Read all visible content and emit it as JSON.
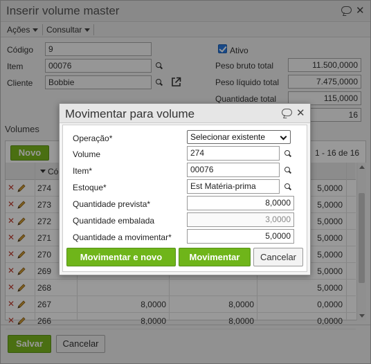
{
  "window": {
    "title": "Inserir volume master",
    "help_icon": "speech-bubble-icon",
    "close_icon": "close-icon"
  },
  "menu": {
    "acoes": "Ações",
    "consultar": "Consultar"
  },
  "form": {
    "codigo_label": "Código",
    "codigo_value": "9",
    "item_label": "Item",
    "item_value": "00076",
    "cliente_label": "Cliente",
    "cliente_value": "Bobbie",
    "ativo_label": "Ativo",
    "ativo_checked": true,
    "peso_bruto_label": "Peso bruto total",
    "peso_bruto_value": "11.500,0000",
    "peso_liquido_label": "Peso líquido total",
    "peso_liquido_value": "7.475,0000",
    "quantidade_label": "Quantidade total",
    "quantidade_value": "115,0000",
    "extra_value": "16"
  },
  "volumes": {
    "title": "Volumes",
    "novo_label": "Novo",
    "pager_text": "1 - 16 de 16",
    "header_col1": "Cód",
    "rows": [
      {
        "codigo": "274",
        "c2": "",
        "c3": "",
        "c4": "5,0000"
      },
      {
        "codigo": "273",
        "c2": "",
        "c3": "",
        "c4": "5,0000"
      },
      {
        "codigo": "272",
        "c2": "",
        "c3": "",
        "c4": "5,0000"
      },
      {
        "codigo": "271",
        "c2": "",
        "c3": "",
        "c4": "5,0000"
      },
      {
        "codigo": "270",
        "c2": "",
        "c3": "",
        "c4": "5,0000"
      },
      {
        "codigo": "269",
        "c2": "",
        "c3": "",
        "c4": "5,0000"
      },
      {
        "codigo": "268",
        "c2": "",
        "c3": "",
        "c4": "5,0000"
      },
      {
        "codigo": "267",
        "c2": "8,0000",
        "c3": "8,0000",
        "c4": "0,0000"
      },
      {
        "codigo": "266",
        "c2": "8,0000",
        "c3": "8,0000",
        "c4": "0,0000"
      }
    ]
  },
  "footer": {
    "salvar_label": "Salvar",
    "cancelar_label": "Cancelar"
  },
  "modal": {
    "title": "Movimentar para volume",
    "operacao_label": "Operação*",
    "operacao_value": "Selecionar existente",
    "volume_label": "Volume",
    "volume_value": "274",
    "item_label": "Item*",
    "item_value": "00076",
    "estoque_label": "Estoque*",
    "estoque_value": "Est Matéria-prima",
    "qtd_prevista_label": "Quantidade prevista*",
    "qtd_prevista_value": "8,0000",
    "qtd_embalada_label": "Quantidade embalada",
    "qtd_embalada_value": "3,0000",
    "qtd_movimentar_label": "Quantidade a movimentar*",
    "qtd_movimentar_value": "5,0000",
    "btn_movimentar_novo": "Movimentar e novo",
    "btn_movimentar": "Movimentar",
    "btn_cancelar": "Cancelar"
  },
  "colors": {
    "accent_green": "#7cba1e",
    "checkbox_blue": "#2a7ae2",
    "delete_red": "#c0392b"
  }
}
